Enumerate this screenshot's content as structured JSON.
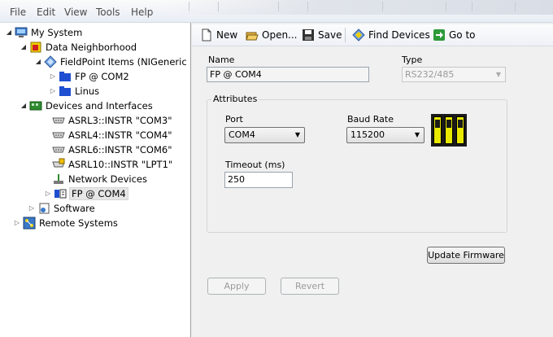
{
  "menu": [
    "File",
    "Edit",
    "View",
    "Tools",
    "Help"
  ],
  "tree": {
    "items": [
      {
        "label": "My System",
        "icon": "computer-icon"
      },
      {
        "label": "Data Neighborhood",
        "icon": "data-neighborhood-icon"
      },
      {
        "label": "FieldPoint Items (NIGeneric",
        "icon": "fieldpoint-items-icon"
      },
      {
        "label": "FP @ COM2",
        "icon": "folder-icon"
      },
      {
        "label": "Linus",
        "icon": "folder-icon"
      },
      {
        "label": "Devices and Interfaces",
        "icon": "devices-icon"
      },
      {
        "label": "ASRL3::INSTR \"COM3\"",
        "icon": "serial-port-icon"
      },
      {
        "label": "ASRL4::INSTR \"COM4\"",
        "icon": "serial-port-icon"
      },
      {
        "label": "ASRL6::INSTR \"COM6\"",
        "icon": "serial-port-icon"
      },
      {
        "label": "ASRL10::INSTR \"LPT1\"",
        "icon": "parallel-port-icon"
      },
      {
        "label": "Network Devices",
        "icon": "network-devices-icon"
      },
      {
        "label": "FP @ COM4",
        "icon": "fieldpoint-device-icon"
      },
      {
        "label": "Software",
        "icon": "software-icon"
      },
      {
        "label": "Remote Systems",
        "icon": "remote-systems-icon"
      }
    ]
  },
  "toolbar": {
    "new_label": "New",
    "open_label": "Open...",
    "save_label": "Save",
    "find_devices_label": "Find Devices",
    "go_to_label": "Go to"
  },
  "form": {
    "name_label": "Name",
    "name_value": "FP @ COM4",
    "type_label": "Type",
    "type_value": "RS232/485",
    "attributes_label": "Attributes",
    "port_label": "Port",
    "port_value": "COM4",
    "baud_label": "Baud Rate",
    "baud_value": "115200",
    "timeout_label": "Timeout (ms)",
    "timeout_value": "250",
    "update_firmware_label": "Update Firmware",
    "apply_label": "Apply",
    "revert_label": "Revert"
  },
  "colors": {
    "selection": "#e6e6e6",
    "accent_blue": "#1f4fd0",
    "dip_yellow": "#e8e800"
  }
}
